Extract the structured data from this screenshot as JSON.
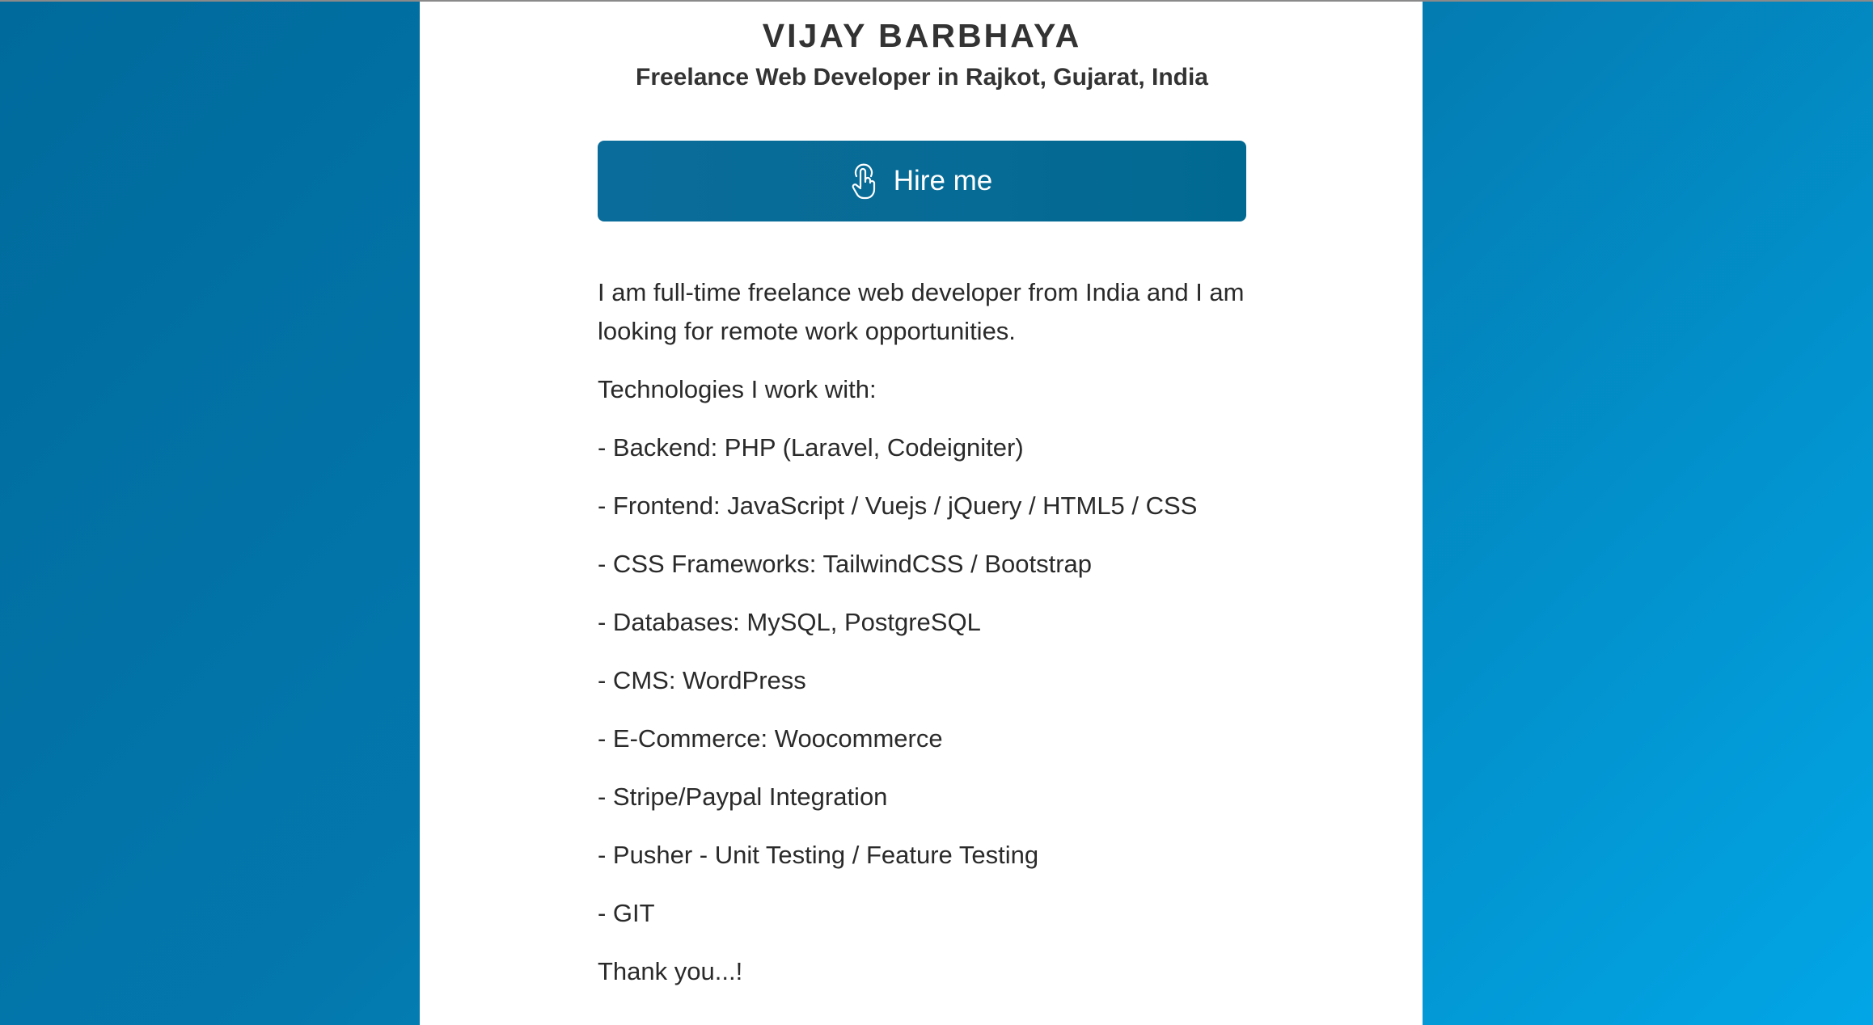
{
  "profile": {
    "name": "VIJAY BARBHAYA",
    "subtitle": "Freelance Web Developer in Rajkot, Gujarat, India"
  },
  "hire_button": {
    "label": "Hire me",
    "icon": "touch-icon"
  },
  "intro": "I am full-time freelance web developer from India and I am looking for remote work opportunities.",
  "tech_heading": "Technologies I work with:",
  "technologies": [
    "- Backend: PHP (Laravel, Codeigniter)",
    "- Frontend: JavaScript / Vuejs / jQuery / HTML5 / CSS",
    "- CSS Frameworks: TailwindCSS / Bootstrap",
    "- Databases: MySQL, PostgreSQL",
    "- CMS: WordPress",
    "- E-Commerce: Woocommerce",
    "- Stripe/Paypal Integration",
    "- Pusher - Unit Testing / Feature Testing",
    "- GIT"
  ],
  "closing": "Thank you...!",
  "colors": {
    "background_start": "#006a9c",
    "background_end": "#02a6e6",
    "button": "#066b95",
    "text": "#2a2a2a"
  }
}
